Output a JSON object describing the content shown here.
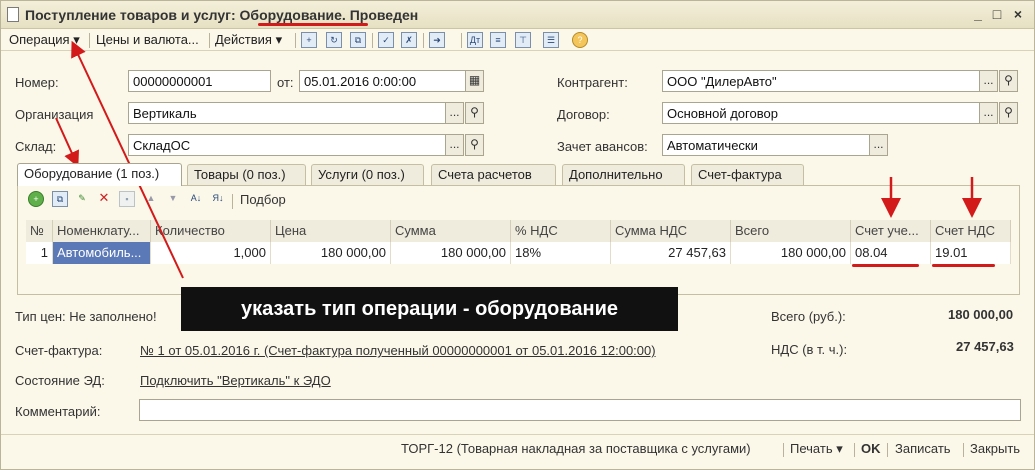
{
  "window": {
    "title_prefix": "Поступление товаров и услуг: ",
    "title_highlight": "Оборудование",
    "title_suffix": ". Проведен",
    "minimize": "_",
    "maximize": "□",
    "close": "×"
  },
  "toolbar": {
    "operation": "Операция",
    "prices": "Цены и валюта...",
    "actions": "Действия"
  },
  "header": {
    "number_label": "Номер:",
    "number_value": "00000000001",
    "date_label": "от:",
    "date_value": "05.01.2016  0:00:00",
    "org_label": "Организация",
    "org_value": "Вертикаль",
    "warehouse_label": "Склад:",
    "warehouse_value": "СкладОС",
    "contractor_label": "Контрагент:",
    "contractor_value": "ООО \"ДилерАвто\"",
    "contract_label": "Договор:",
    "contract_value": "Основной договор",
    "advance_label": "Зачет авансов:",
    "advance_value": "Автоматически"
  },
  "tabs": [
    {
      "label": "Оборудование (1 поз.)"
    },
    {
      "label": "Товары (0 поз.)"
    },
    {
      "label": "Услуги (0 поз.)"
    },
    {
      "label": "Счета расчетов"
    },
    {
      "label": "Дополнительно"
    },
    {
      "label": "Счет-фактура"
    }
  ],
  "table_toolbar": {
    "selection": "Подбор"
  },
  "table": {
    "columns": [
      "№",
      "Номенклату...",
      "Количество",
      "Цена",
      "Сумма",
      "% НДС",
      "Сумма НДС",
      "Всего",
      "Счет уче...",
      "Счет НДС"
    ],
    "rows": [
      [
        "1",
        "Автомобиль...",
        "1,000",
        "180 000,00",
        "180 000,00",
        "18%",
        "27 457,63",
        "180 000,00",
        "08.04",
        "19.01"
      ]
    ]
  },
  "footer": {
    "price_type": "Тип цен: Не заполнено!",
    "total_label": "Всего (руб.):",
    "total_value": "180 000,00",
    "invoice_label": "Счет-фактура:",
    "invoice_link": "№ 1 от 05.01.2016 г. (Счет-фактура полученный 00000000001 от 05.01.2016 12:00:00)",
    "vat_label": "НДС (в т. ч.):",
    "vat_value": "27 457,63",
    "edo_label": "Состояние ЭД:",
    "edo_link": "Подключить \"Вертикаль\" к ЭДО",
    "comment_label": "Комментарий:",
    "comment_value": ""
  },
  "bottom_bar": {
    "torg": "ТОРГ-12 (Товарная накладная за поставщика с услугами)",
    "print": "Печать",
    "ok": "OK",
    "save": "Записать",
    "close": "Закрыть"
  },
  "annotation": {
    "banner": "указать тип операции - оборудование"
  },
  "colors": {
    "annotation_red": "#d21a1a",
    "background": "#fbf8ea",
    "selected_cell": "#5b79b6"
  }
}
